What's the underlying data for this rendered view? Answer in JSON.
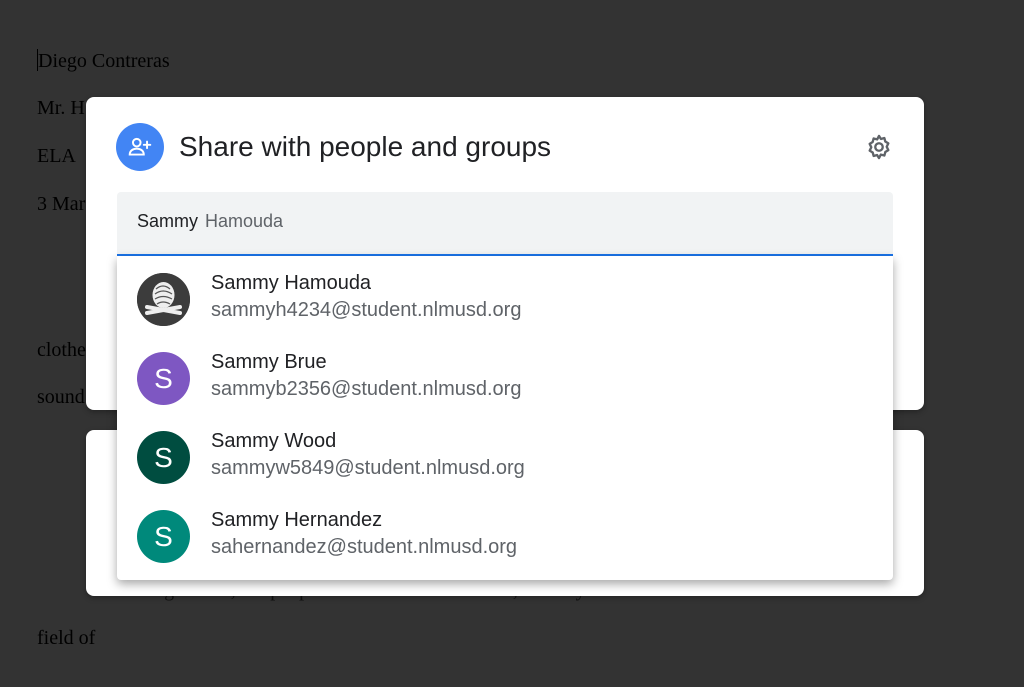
{
  "document": {
    "lines": [
      "Diego Contreras",
      "Mr. H",
      "ELA",
      "3 Mar",
      "clothe",
      "sound",
      "field of"
    ],
    "partial_line": "...relating with it, the people around it and the scene, the ways that rise to the"
  },
  "share_dialog": {
    "title": "Share with people and groups",
    "header_icon": "person-add-icon",
    "settings_icon": "gear-icon",
    "input": {
      "typed": "Sammy",
      "autocomplete": "Hamouda"
    },
    "suggestions": [
      {
        "name": "Sammy Hamouda",
        "email": "sammyh4234@student.nlmusd.org",
        "initial": "",
        "avatar_type": "photo",
        "color": "#3c3c3c"
      },
      {
        "name": "Sammy Brue",
        "email": "sammyb2356@student.nlmusd.org",
        "initial": "S",
        "avatar_type": "letter",
        "color": "#7e57c2"
      },
      {
        "name": "Sammy Wood",
        "email": "sammyw5849@student.nlmusd.org",
        "initial": "S",
        "avatar_type": "letter",
        "color": "#004d40"
      },
      {
        "name": "Sammy Hernandez",
        "email": "sahernandez@student.nlmusd.org",
        "initial": "S",
        "avatar_type": "letter",
        "color": "#00897b"
      }
    ]
  },
  "colors": {
    "background": "#333333",
    "accent": "#1a73e8",
    "header_icon_bg": "#4285f4"
  }
}
